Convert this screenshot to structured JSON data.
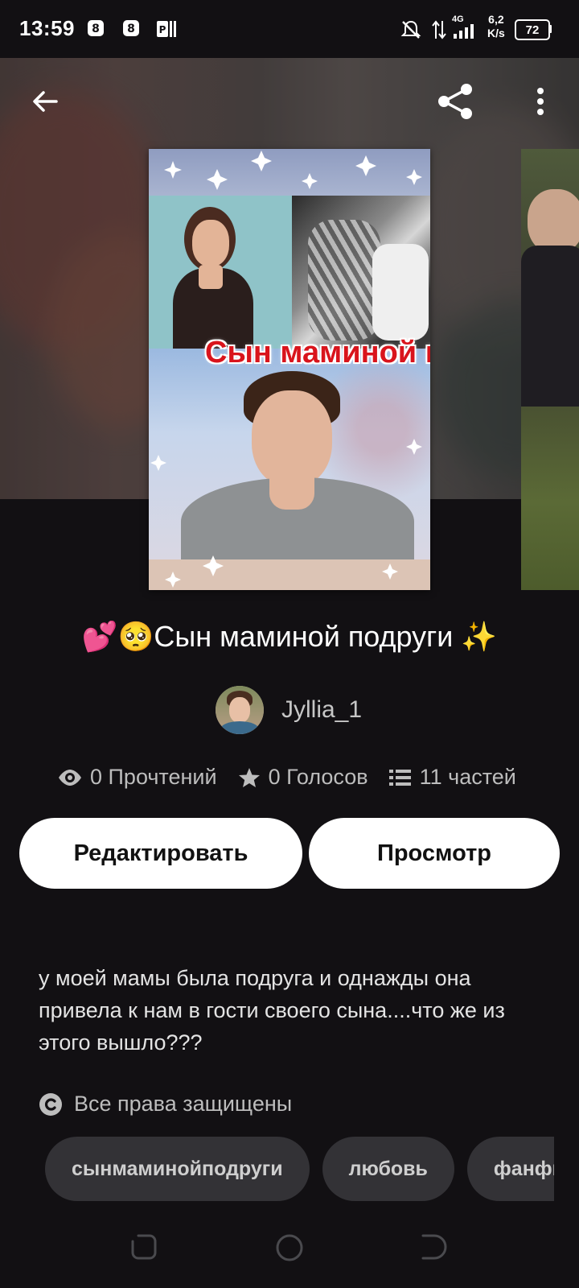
{
  "status_bar": {
    "time": "13:59",
    "network_speed_value": "6,2",
    "network_speed_unit": "K/s",
    "network_type": "4G",
    "battery": "72"
  },
  "story": {
    "cover_title": "Сын маминой подруги",
    "title": "💕🥺Сын маминой подруги ✨",
    "author": "Jyllia_1",
    "stats": {
      "reads": "0 Прочтений",
      "votes": "0 Голосов",
      "parts": "11 частей"
    },
    "description": "у моей мамы была подруга и однажды она привела к нам в гости своего сына....что же из этого вышло???",
    "copyright": "Все права защищены",
    "tags": [
      "сынмаминойподруги",
      "любовь",
      "фанфик"
    ]
  },
  "actions": {
    "edit_label": "Редактировать",
    "preview_label": "Просмотр"
  },
  "icons": {
    "back": "arrow-left-icon",
    "share": "share-icon",
    "more": "more-vertical-icon",
    "reads": "eye-icon",
    "votes": "star-icon",
    "parts": "list-icon",
    "copyright": "copyright-icon"
  },
  "colors": {
    "background": "#121013",
    "button_bg": "#ffffff",
    "tag_bg": "#333236",
    "cover_title_red": "#d9141c"
  }
}
